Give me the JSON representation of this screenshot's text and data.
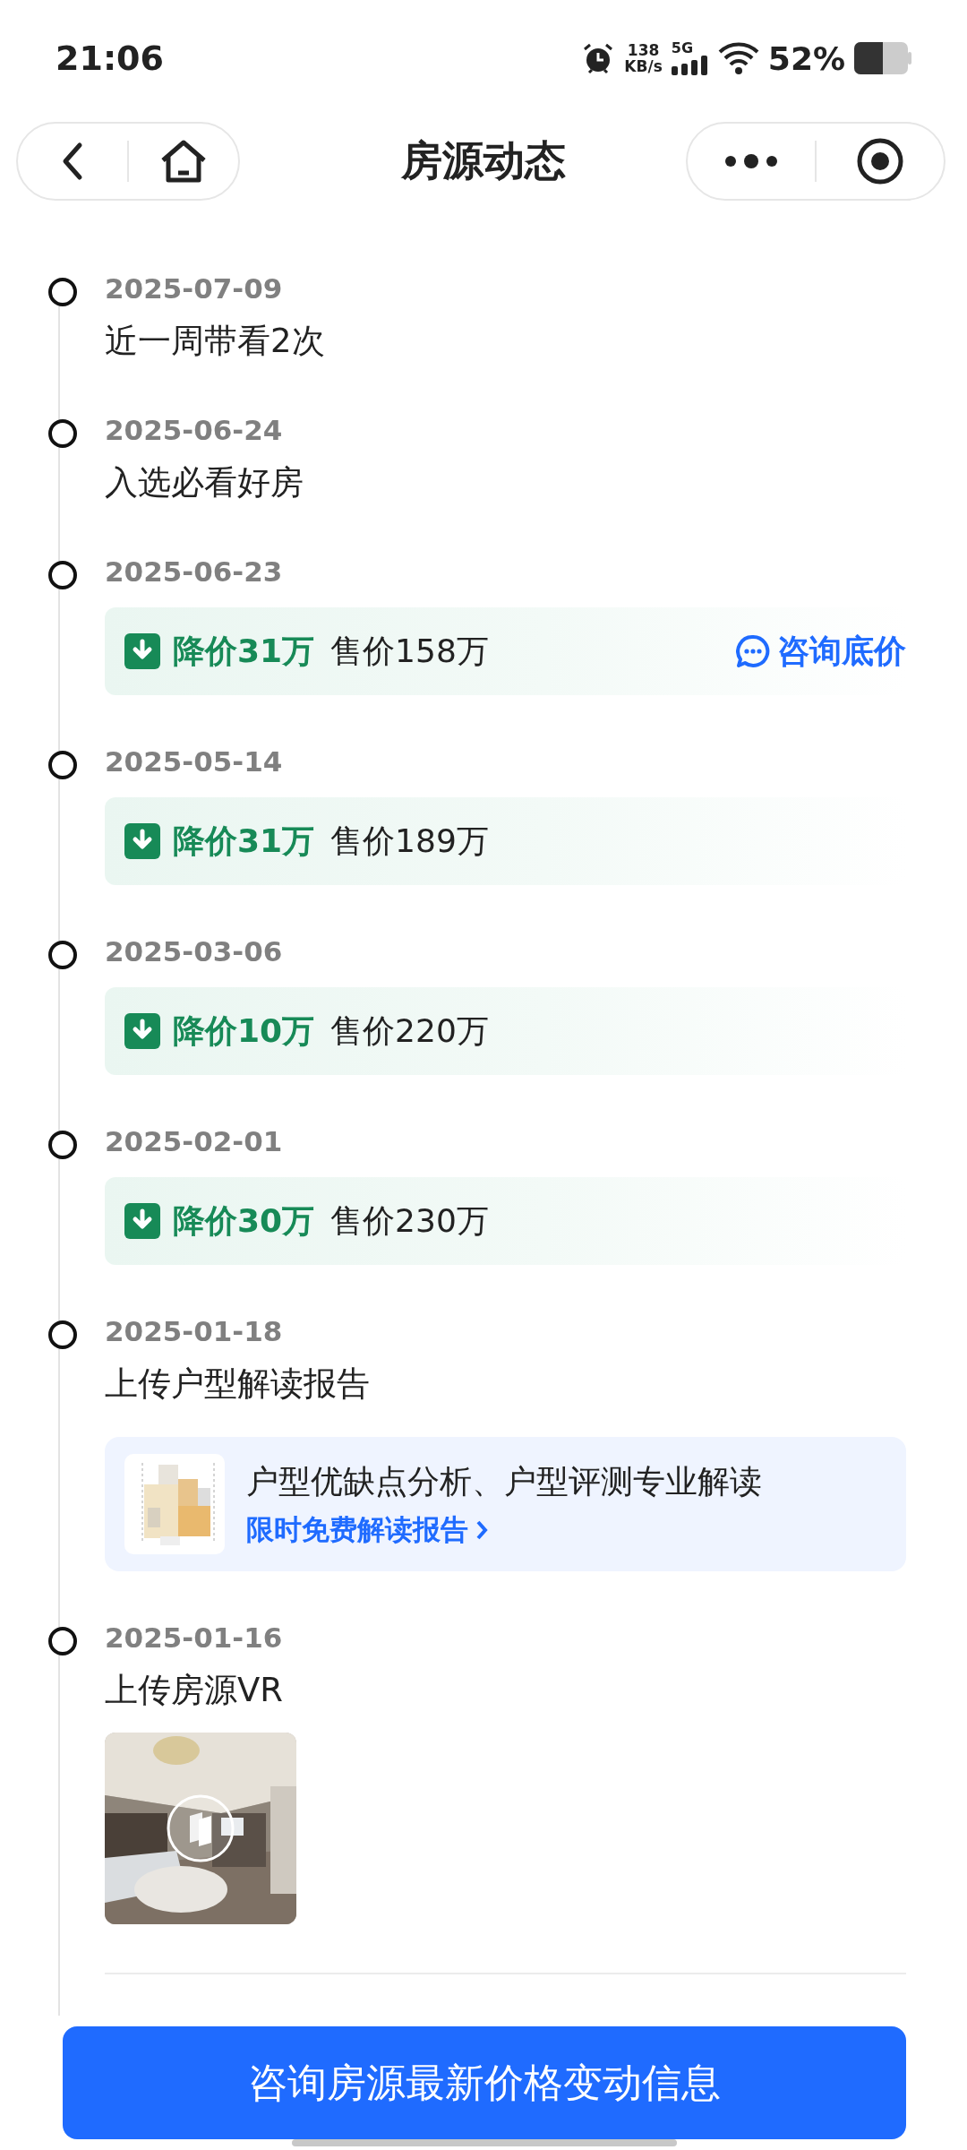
{
  "status_bar": {
    "time": "21:06",
    "speed_value": "138",
    "speed_unit": "KB/s",
    "network": "5G",
    "battery": "52%"
  },
  "nav": {
    "title": "房源动态"
  },
  "events": [
    {
      "kind": "text",
      "date": "2025-07-09",
      "title": "近一周带看2次"
    },
    {
      "kind": "text",
      "date": "2025-06-24",
      "title": "入选必看好房"
    },
    {
      "kind": "price",
      "date": "2025-06-23",
      "drop": "降价31万",
      "price": "售价158万",
      "link": "咨询底价"
    },
    {
      "kind": "price",
      "date": "2025-05-14",
      "drop": "降价31万",
      "price": "售价189万"
    },
    {
      "kind": "price",
      "date": "2025-03-06",
      "drop": "降价10万",
      "price": "售价220万"
    },
    {
      "kind": "price",
      "date": "2025-02-01",
      "drop": "降价30万",
      "price": "售价230万"
    },
    {
      "kind": "report",
      "date": "2025-01-18",
      "title": "上传户型解读报告",
      "card_text": "户型优缺点分析、户型评测专业解读",
      "card_link": "限时免费解读报告"
    },
    {
      "kind": "vr",
      "date": "2025-01-16",
      "title": "上传房源VR"
    }
  ],
  "bottom_button": "咨询房源最新价格变动信息"
}
